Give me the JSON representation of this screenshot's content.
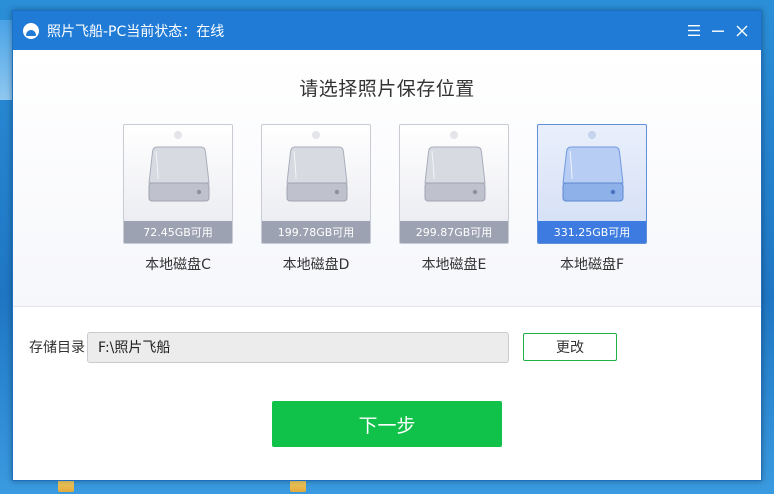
{
  "window": {
    "title": "照片飞船-PC当前状态：在线",
    "controls": [
      "menu-icon",
      "minimize-icon",
      "close-icon"
    ]
  },
  "main": {
    "heading": "请选择照片保存位置",
    "drives": [
      {
        "label": "本地磁盘C",
        "free": "72.45GB可用",
        "selected": false
      },
      {
        "label": "本地磁盘D",
        "free": "199.78GB可用",
        "selected": false
      },
      {
        "label": "本地磁盘E",
        "free": "299.87GB可用",
        "selected": false
      },
      {
        "label": "本地磁盘F",
        "free": "331.25GB可用",
        "selected": true
      }
    ]
  },
  "storage": {
    "label": "存储目录",
    "path": "F:\\照片飞船",
    "change_label": "更改"
  },
  "next_label": "下一步",
  "colors": {
    "titlebar": "#1f7bd6",
    "accent_green": "#11c24a",
    "drive_bar": "#9ca2b1",
    "drive_bar_selected": "#3d7be0"
  }
}
